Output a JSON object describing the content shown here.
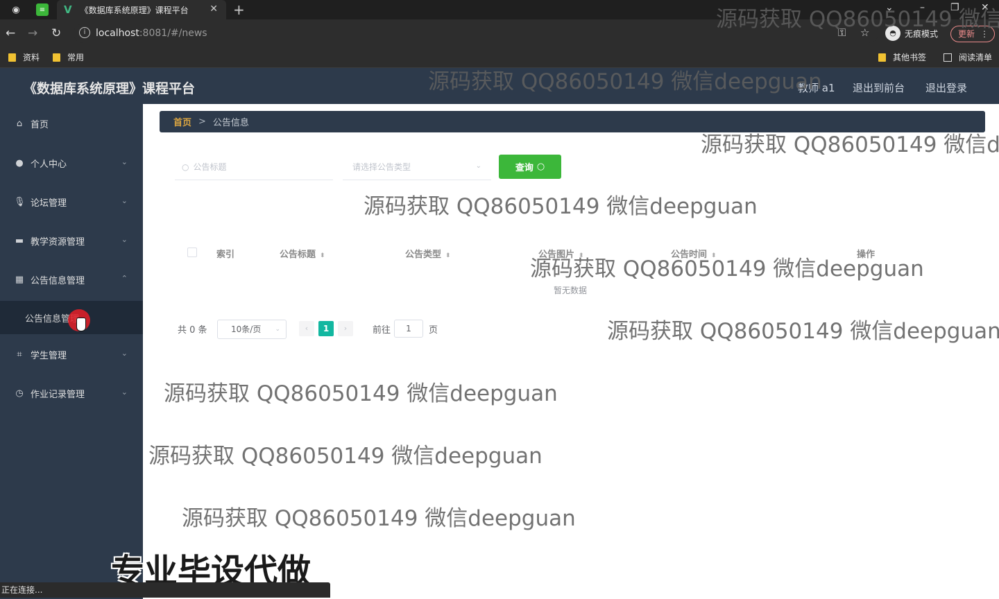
{
  "browser": {
    "tab_title": "《数据库系统原理》课程平台",
    "url_host": "localhost",
    "url_rest": ":8081/#/news",
    "incognito_label": "无痕模式",
    "update_label": "更新",
    "bookmarks": [
      "资料",
      "常用",
      "其他书签",
      "阅读清单"
    ]
  },
  "header": {
    "title": "《数据库系统原理》课程平台",
    "user": "教师 a1",
    "front_link": "退出到前台",
    "logout_link": "退出登录"
  },
  "sidebar": {
    "items": [
      {
        "label": "首页"
      },
      {
        "label": "个人中心"
      },
      {
        "label": "论坛管理"
      },
      {
        "label": "教学资源管理"
      },
      {
        "label": "公告信息管理"
      },
      {
        "label": "学生管理"
      },
      {
        "label": "作业记录管理"
      }
    ],
    "submenu_active": "公告信息管理"
  },
  "breadcrumb": {
    "home": "首页",
    "sep": ">",
    "current": "公告信息"
  },
  "search": {
    "title_placeholder": "公告标题",
    "type_placeholder": "请选择公告类型",
    "query_label": "查询"
  },
  "table": {
    "headers": [
      "索引",
      "公告标题",
      "公告类型",
      "公告图片",
      "公告时间",
      "操作"
    ],
    "empty_text": "暂无数据"
  },
  "pagination": {
    "total": "共 0 条",
    "page_size": "10条/页",
    "current_page": "1",
    "goto_label": "前往",
    "goto_value": "1",
    "page_suffix": "页"
  },
  "watermark": {
    "text": "源码获取 QQ86050149 微信deepguan",
    "text_cut1": "源码获取 QQ86050149 微信d",
    "text_cut2": "源码获取 QQ86050149 微信de",
    "slogan": "专业毕设代做"
  },
  "status": {
    "text": "正在连接..."
  },
  "colors": {
    "sidebar_bg": "#2d3a4b",
    "primary_green": "#3cb73a",
    "page_active": "#12b7a0",
    "breadcrumb_home": "#d9a441"
  }
}
